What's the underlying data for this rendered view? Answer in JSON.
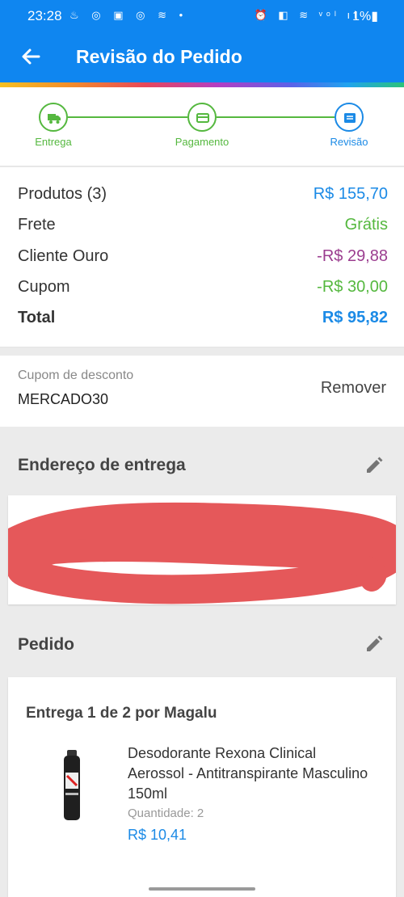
{
  "status_bar": {
    "time": "23:28",
    "left_icons": "♨ ◎ ▣ ◎ ≋ •",
    "right_icons": "⏰ ◧ ≋ ᵛᵒˡ ıl",
    "battery": "1%▮"
  },
  "app_bar": {
    "title": "Revisão do Pedido",
    "back_icon": "arrow-left-icon"
  },
  "stepper": {
    "steps": [
      {
        "label": "Entrega",
        "icon": "truck-icon",
        "state": "done"
      },
      {
        "label": "Pagamento",
        "icon": "card-icon",
        "state": "done"
      },
      {
        "label": "Revisão",
        "icon": "list-icon",
        "state": "current"
      }
    ]
  },
  "summary": {
    "products_label": "Produtos (3)",
    "products_value": "R$ 155,70",
    "shipping_label": "Frete",
    "shipping_value": "Grátis",
    "gold_label": "Cliente Ouro",
    "gold_value": "-R$ 29,88",
    "coupon_label": "Cupom",
    "coupon_value": "-R$ 30,00",
    "total_label": "Total",
    "total_value": "R$ 95,82"
  },
  "coupon": {
    "caption": "Cupom de desconto",
    "code": "MERCADO30",
    "remove_label": "Remover"
  },
  "address": {
    "title": "Endereço de entrega",
    "edit_icon": "pencil-icon"
  },
  "order": {
    "title": "Pedido",
    "edit_icon": "pencil-icon",
    "shipment": "Entrega 1 de 2 por Magalu",
    "product": {
      "name": "Desodorante Rexona Clinical Aerossol - Antitranspirante Masculino 150ml",
      "quantity_label": "Quantidade:",
      "quantity": "2",
      "price": "R$ 10,41"
    }
  },
  "colors": {
    "primary": "#0f86f0",
    "accent_blue": "#1b8ae6",
    "green": "#55b83f",
    "purple": "#9b3d8f",
    "redaction": "#e5585a"
  }
}
